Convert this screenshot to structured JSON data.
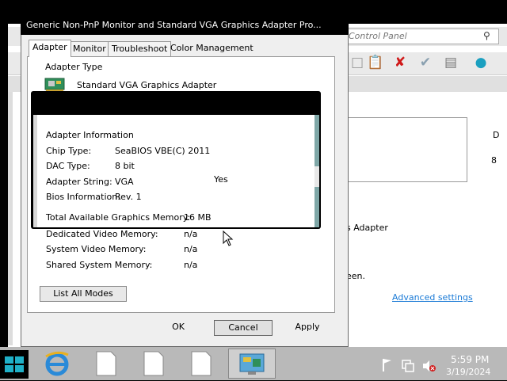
{
  "dialog": {
    "title": "Generic Non-PnP Monitor and Standard VGA Graphics Adapter Pro...",
    "tabs": [
      {
        "label": "Adapter",
        "active": true
      },
      {
        "label": "Monitor",
        "active": false
      },
      {
        "label": "Troubleshoot",
        "active": false
      },
      {
        "label": "Color Management",
        "active": false
      }
    ],
    "adapter_type_label": "Adapter Type",
    "adapter_type_value": "Standard VGA Graphics Adapter",
    "adapter_info_label": "Adapter Information",
    "info": {
      "chip_type_label": "Chip Type:",
      "chip_type_value": "SeaBIOS VBE(C) 2011",
      "dac_type_label": "DAC Type:",
      "dac_type_value": "8 bit",
      "adapter_string_label": "Adapter String:",
      "adapter_string_value": "VGA",
      "bios_info_label": "Bios Information:",
      "bios_info_value": "Rev. 1",
      "yes_text": "Yes"
    },
    "memory": {
      "total_label": "Total Available Graphics Memory:",
      "total_value": "16 MB",
      "dedicated_label": "Dedicated Video Memory:",
      "dedicated_value": "n/a",
      "system_label": "System Video Memory:",
      "system_value": "n/a",
      "shared_label": "Shared System Memory:",
      "shared_value": "n/a"
    },
    "list_all_modes_label": "List All Modes",
    "ok_label": "OK",
    "cancel_label": "Cancel",
    "apply_label": "Apply"
  },
  "background_window": {
    "search_placeholder": "Control Panel",
    "adapter_fragment": "s Adapter",
    "screen_fragment": "een.",
    "advanced_settings_link": "Advanced settings",
    "right_char_1": "D",
    "right_char_2": "8"
  },
  "taskbar": {
    "time": "5:59 PM",
    "date": "3/19/2024"
  },
  "colors": {
    "accent_link": "#1a7ad6",
    "taskbar": "#b9b9b9",
    "start_tile": "#1fb0c8"
  }
}
